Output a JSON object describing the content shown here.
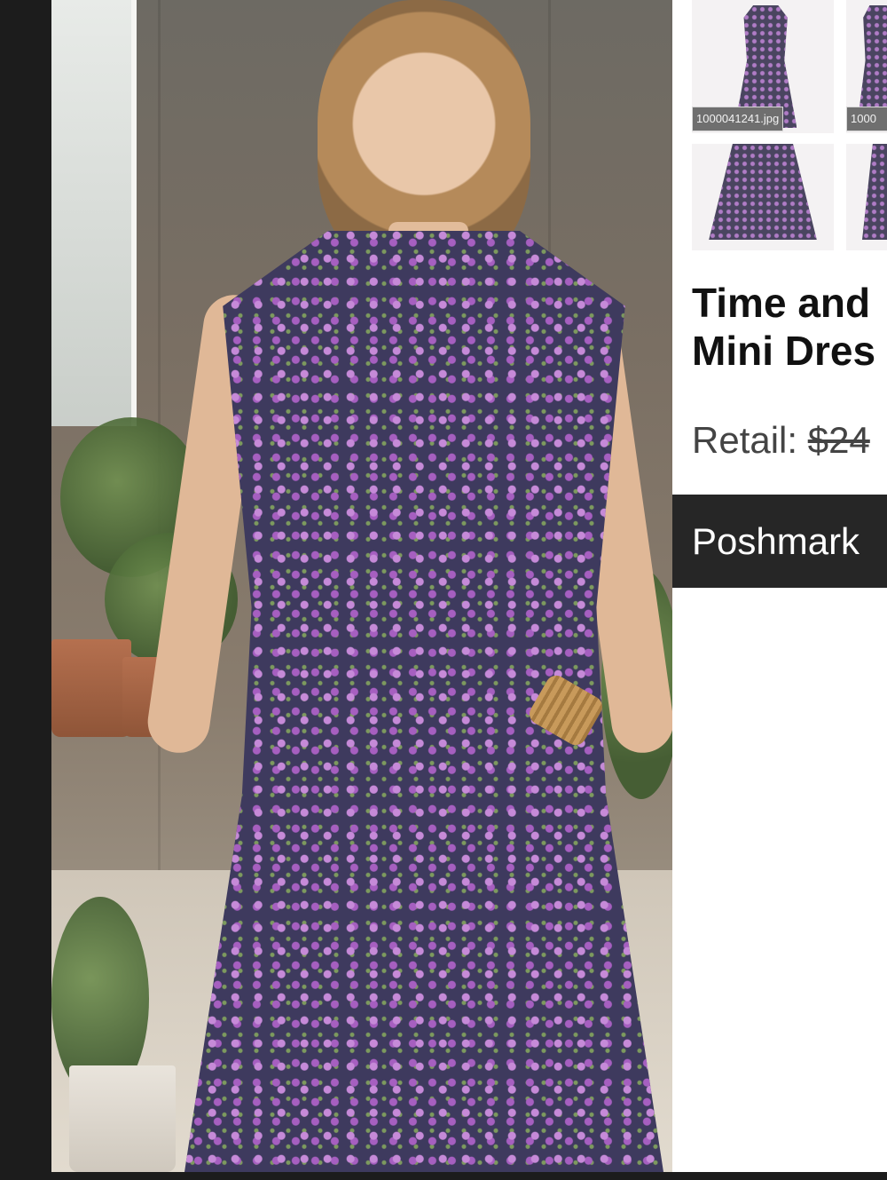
{
  "thumbnails": [
    {
      "filename": "1000041241.jpg",
      "kind": "full-dress"
    },
    {
      "filename": "1000",
      "kind": "full-dress"
    },
    {
      "filename": "",
      "kind": "skirt"
    },
    {
      "filename": "",
      "kind": "skirt"
    }
  ],
  "product": {
    "title_line1": "Time and",
    "title_line2": "Mini Dres",
    "retail_label": "Retail: ",
    "retail_price": "$24"
  },
  "cta": {
    "label": "Poshmark"
  },
  "colors": {
    "dress_base": "#3e3a5e",
    "flower": "#c68ad8",
    "button_bg": "#262626"
  }
}
